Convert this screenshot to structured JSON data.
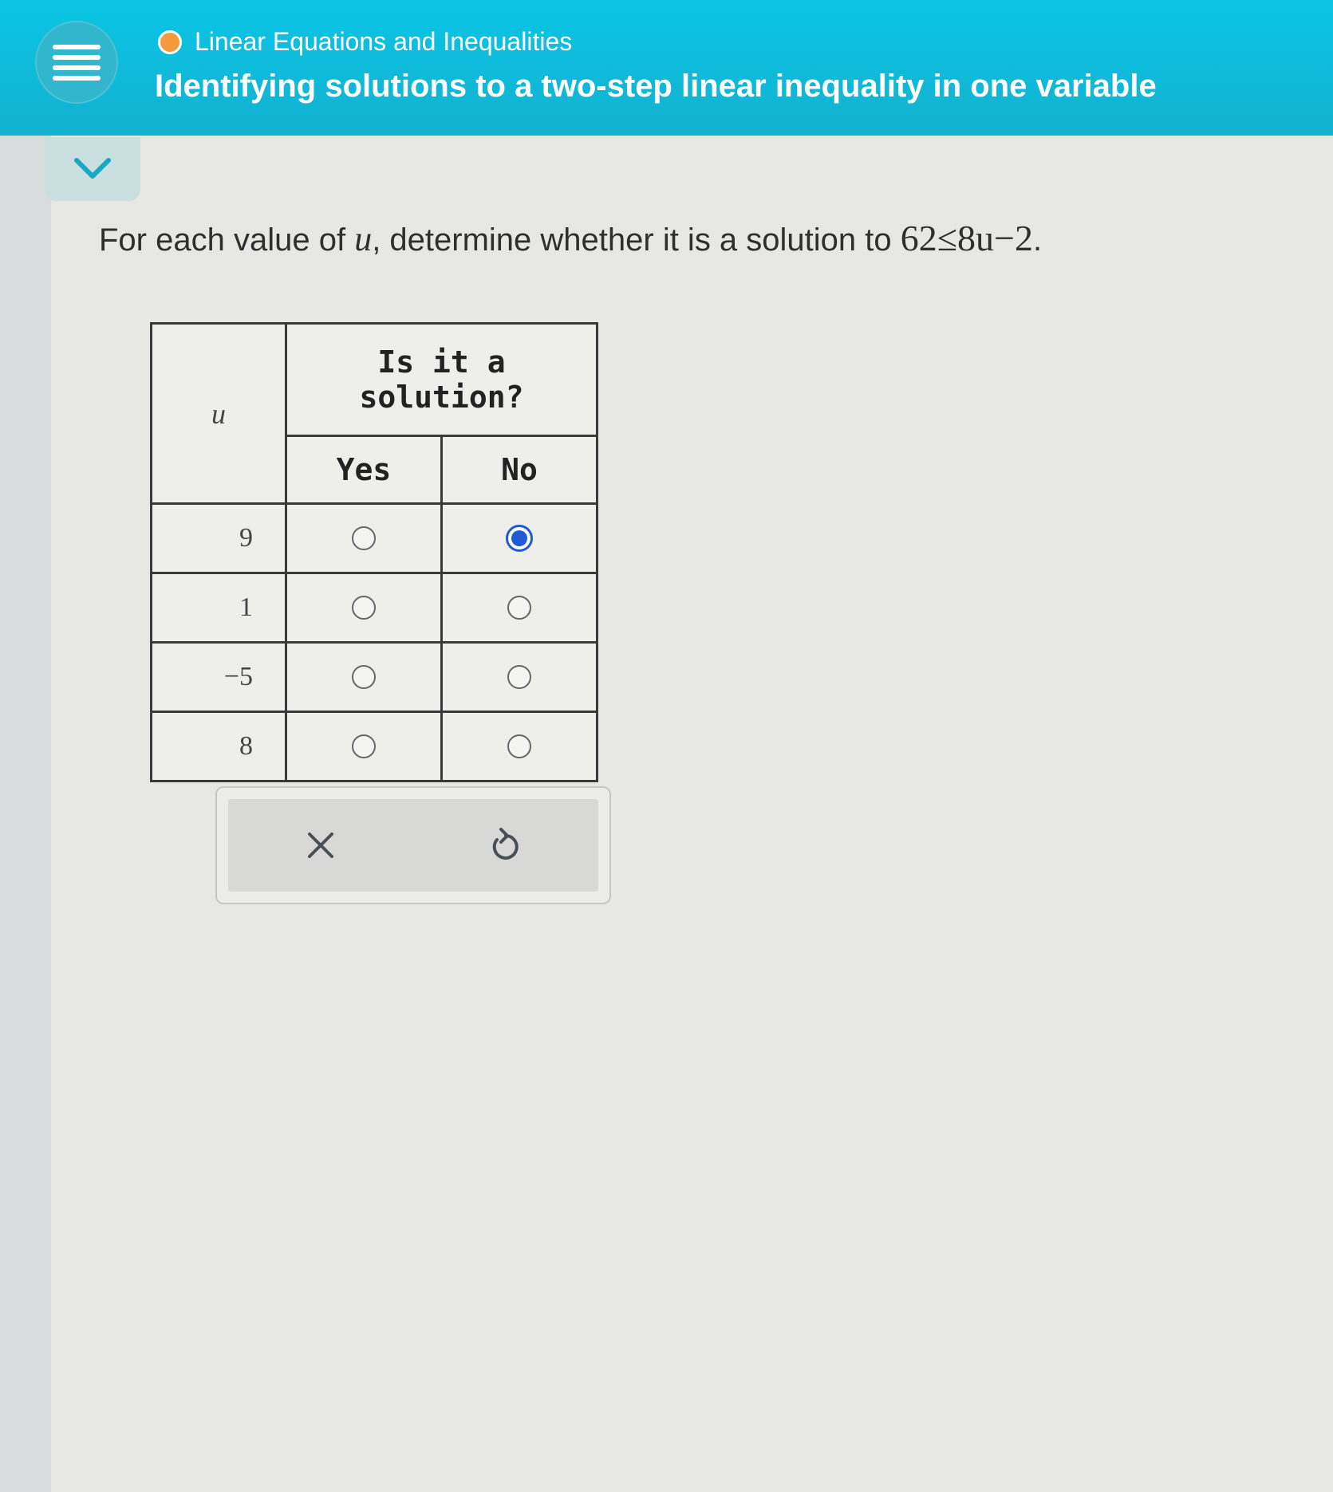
{
  "header": {
    "topic": "Linear Equations and Inequalities",
    "lesson_title": "Identifying solutions to a two-step linear inequality in one variable",
    "topic_status_color": "#f59a3a",
    "accent_color": "#0bc5e6"
  },
  "icons": {
    "menu": "hamburger-menu-icon",
    "collapse": "chevron-down-icon",
    "clear": "close-icon",
    "undo": "undo-icon"
  },
  "question": {
    "prefix": "For each value of",
    "variable": "u",
    "middle": ", determine whether it is a solution to",
    "inequality": "62≤8u−2",
    "suffix": "."
  },
  "table": {
    "variable_header": "u",
    "group_header": "Is it a solution?",
    "yes_label": "Yes",
    "no_label": "No",
    "rows": [
      {
        "value": "9",
        "selected": "no"
      },
      {
        "value": "1",
        "selected": ""
      },
      {
        "value": "−5",
        "selected": ""
      },
      {
        "value": "8",
        "selected": ""
      }
    ]
  },
  "selection_color": "#1f5bd6"
}
